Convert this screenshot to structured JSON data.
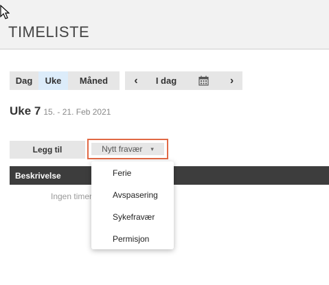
{
  "header": {
    "title": "TIMELISTE"
  },
  "view_tabs": [
    {
      "label": "Dag",
      "active": false
    },
    {
      "label": "Uke",
      "active": true
    },
    {
      "label": "Måned",
      "active": false
    }
  ],
  "nav": {
    "prev": "‹",
    "today": "I dag",
    "calendar_icon": "calendar-icon",
    "next": "›"
  },
  "week": {
    "title": "Uke 7",
    "range": "15. - 21. Feb 2021"
  },
  "actions": {
    "add_label": "Legg til",
    "absence_label": "Nytt fravær",
    "absence_caret": "▾"
  },
  "table": {
    "columns": [
      "Beskrivelse"
    ],
    "empty_text": "Ingen timer"
  },
  "absence_menu": {
    "items": [
      "Ferie",
      "Avspasering",
      "Sykefravær",
      "Permisjon"
    ]
  },
  "colors": {
    "highlight_border": "#e06844",
    "active_tab": "#dcecfa",
    "table_header": "#3d3d3d"
  }
}
